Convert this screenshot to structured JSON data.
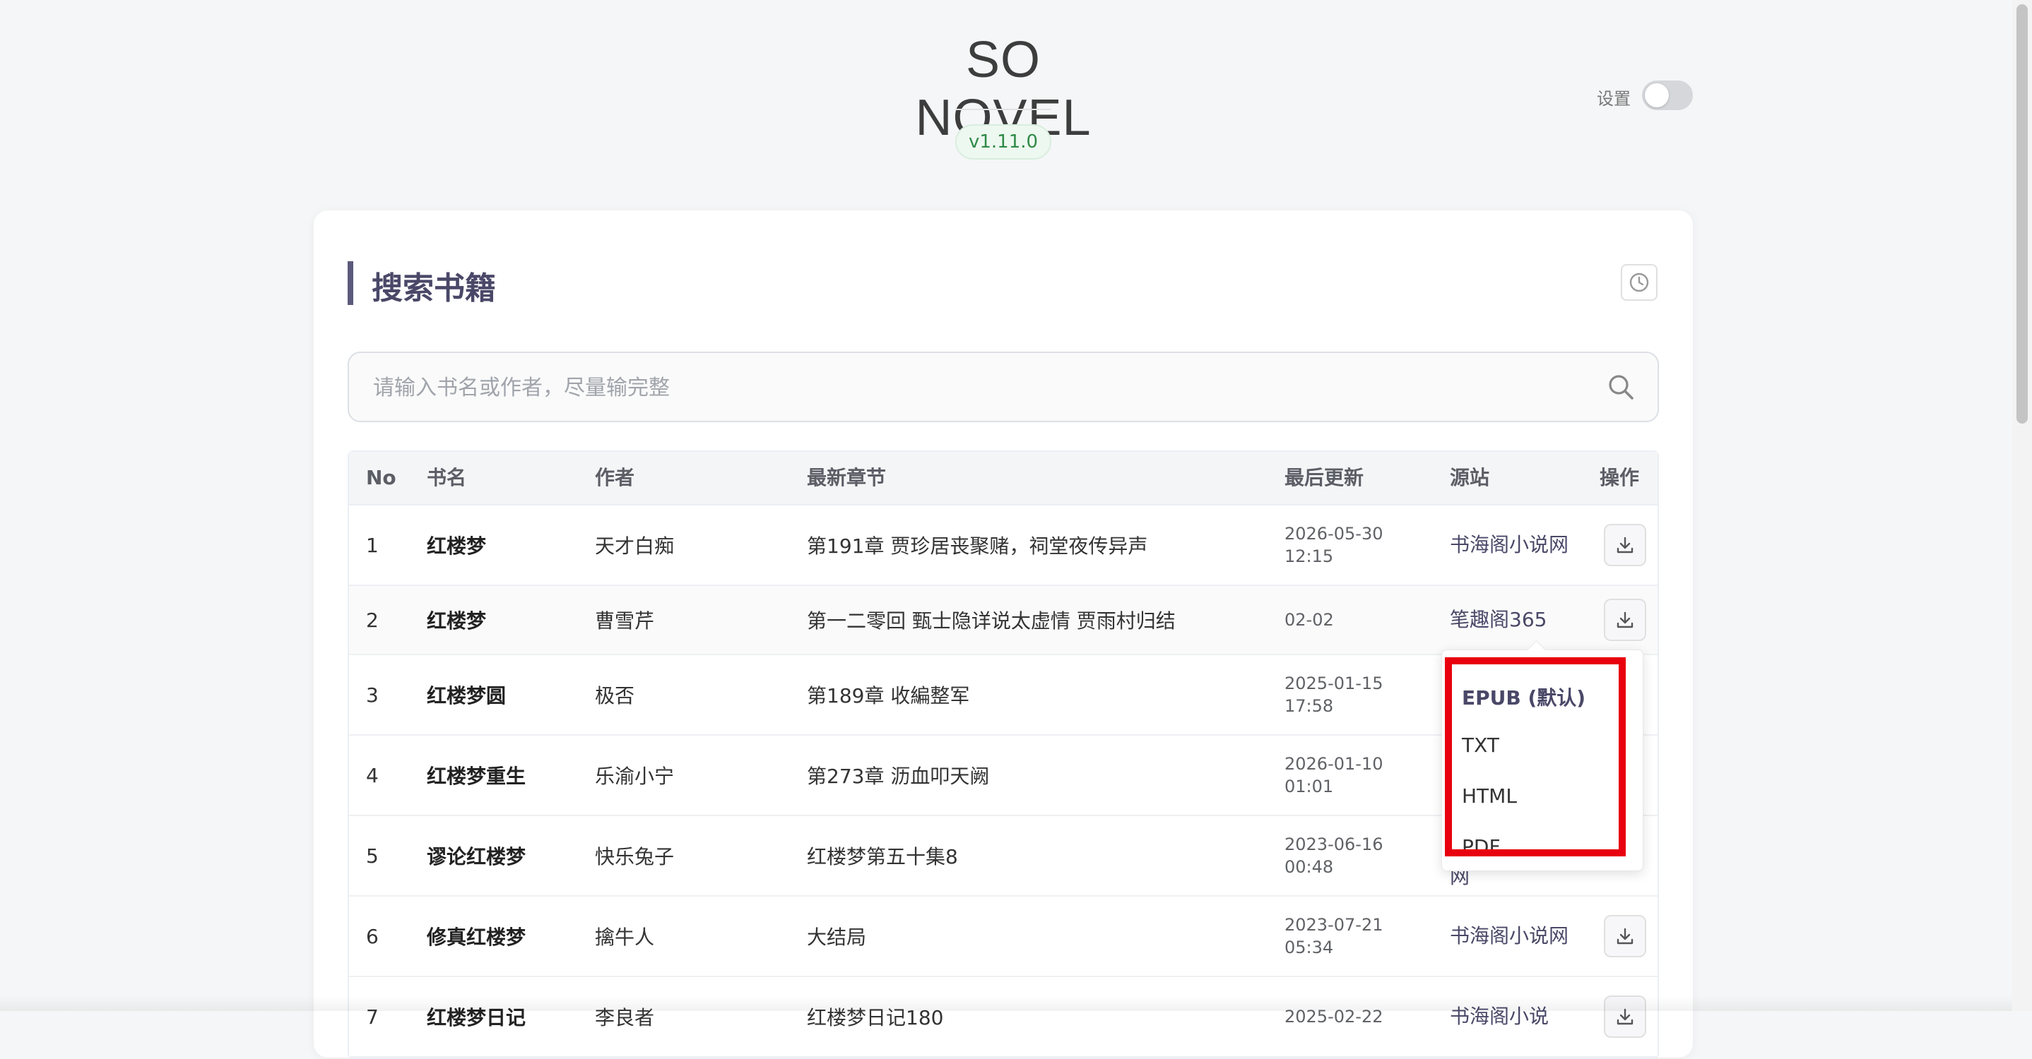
{
  "header": {
    "app_title": "SO NOVEL",
    "version": "v1.11.0",
    "settings_label": "设置",
    "settings_toggle_on": false
  },
  "search": {
    "section_title": "搜索书籍",
    "placeholder": "请输入书名或作者，尽量输完整",
    "value": ""
  },
  "table": {
    "columns": [
      "No",
      "书名",
      "作者",
      "最新章节",
      "最后更新",
      "源站",
      "操作"
    ],
    "rows": [
      {
        "no": "1",
        "name": "红楼梦",
        "author": "天才白痴",
        "latest": "第191章 贾珍居丧聚赌，祠堂夜传异声",
        "update": "2026-05-30 12:15",
        "site": "书海阁小说网"
      },
      {
        "no": "2",
        "name": "红楼梦",
        "author": "曹雪芹",
        "latest": "第一二零回 甄士隐详说太虚情 贾雨村归结",
        "update": "02-02",
        "site": "笔趣阁365"
      },
      {
        "no": "3",
        "name": "红楼梦圆",
        "author": "极否",
        "latest": "第189章 收編整军",
        "update": "2025-01-15 17:58",
        "site": ""
      },
      {
        "no": "4",
        "name": "红楼梦重生",
        "author": "乐渝小宁",
        "latest": "第273章 沥血叩天阙",
        "update": "2026-01-10 01:01",
        "site": ""
      },
      {
        "no": "5",
        "name": "谬论红楼梦",
        "author": "快乐兔子",
        "latest": "红楼梦第五十集8",
        "update": "2023-06-16 00:48",
        "site": "网"
      },
      {
        "no": "6",
        "name": "修真红楼梦",
        "author": "擒牛人",
        "latest": "大结局",
        "update": "2023-07-21 05:34",
        "site": "书海阁小说网"
      },
      {
        "no": "7",
        "name": "红楼梦日记",
        "author": "李良者",
        "latest": "红楼梦日记180",
        "update": "2025-02-22",
        "site": "书海阁小说"
      }
    ]
  },
  "download_menu": {
    "items": [
      "EPUB (默认)",
      "TXT",
      "HTML",
      "PDF"
    ],
    "highlight_color": "#e8000e"
  },
  "colors": {
    "accent": "#4a4868",
    "version_badge": "#2f8a47"
  },
  "icons": {
    "history": "clock-icon",
    "search": "search-icon",
    "download": "download-icon"
  }
}
